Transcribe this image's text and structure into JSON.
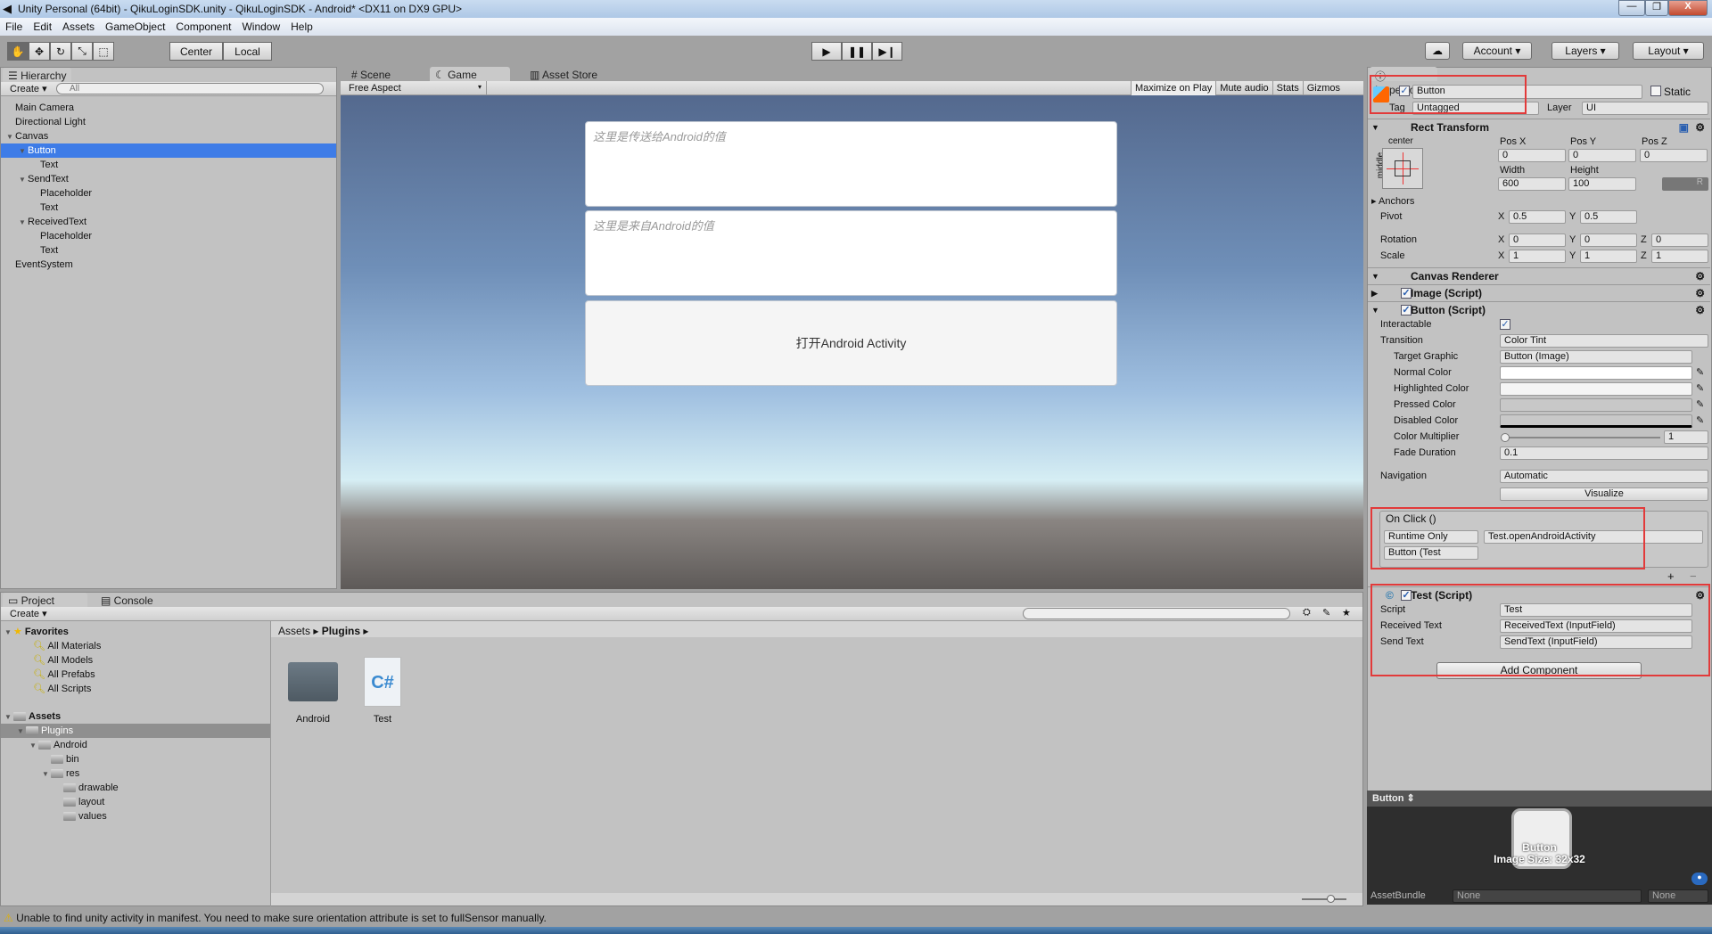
{
  "window": {
    "title": "Unity Personal (64bit) - QikuLoginSDK.unity - QikuLoginSDK - Android* <DX11 on DX9 GPU>",
    "minimize": "—",
    "maximize": "❐",
    "close": "X"
  },
  "menu": [
    "File",
    "Edit",
    "Assets",
    "GameObject",
    "Component",
    "Window",
    "Help"
  ],
  "toolbar": {
    "pivot": "Center",
    "space": "Local",
    "account": "Account",
    "layers": "Layers",
    "layout": "Layout"
  },
  "hierarchy": {
    "tab": "Hierarchy",
    "create": "Create",
    "search_placeholder": "All",
    "items": [
      {
        "label": "Main Camera",
        "depth": 0
      },
      {
        "label": "Directional Light",
        "depth": 0
      },
      {
        "label": "Canvas",
        "depth": 0,
        "expanded": true
      },
      {
        "label": "Button",
        "depth": 1,
        "expanded": true,
        "selected": true
      },
      {
        "label": "Text",
        "depth": 2
      },
      {
        "label": "SendText",
        "depth": 1,
        "expanded": true
      },
      {
        "label": "Placeholder",
        "depth": 2
      },
      {
        "label": "Text",
        "depth": 2
      },
      {
        "label": "ReceivedText",
        "depth": 1,
        "expanded": true
      },
      {
        "label": "Placeholder",
        "depth": 2
      },
      {
        "label": "Text",
        "depth": 2
      },
      {
        "label": "EventSystem",
        "depth": 0
      }
    ]
  },
  "game": {
    "tabs": [
      "Scene",
      "Game",
      "Asset Store"
    ],
    "active_tab": "Game",
    "aspect": "Free Aspect",
    "options": [
      "Maximize on Play",
      "Mute audio",
      "Stats",
      "Gizmos"
    ],
    "send_placeholder": "这里是传送给Android的值",
    "received_placeholder": "这里是来自Android的值",
    "button_label": "打开Android Activity"
  },
  "inspector": {
    "tab": "Inspector",
    "object_name": "Button",
    "active": true,
    "static_label": "Static",
    "tag_label": "Tag",
    "tag": "Untagged",
    "layer_label": "Layer",
    "layer": "UI",
    "rect_transform": {
      "title": "Rect Transform",
      "anchor_h": "center",
      "anchor_v": "middle",
      "pos_x_label": "Pos X",
      "pos_y_label": "Pos Y",
      "pos_z_label": "Pos Z",
      "pos_x": "0",
      "pos_y": "0",
      "pos_z": "0",
      "width_label": "Width",
      "height_label": "Height",
      "width": "600",
      "height": "100",
      "anchors": "Anchors",
      "pivot_label": "Pivot",
      "pivot_x": "0.5",
      "pivot_y": "0.5",
      "rotation_label": "Rotation",
      "rot_x": "0",
      "rot_y": "0",
      "rot_z": "0",
      "scale_label": "Scale",
      "scale_x": "1",
      "scale_y": "1",
      "scale_z": "1",
      "x": "X",
      "y": "Y",
      "z": "Z",
      "r": "R"
    },
    "canvas_renderer": "Canvas Renderer",
    "image_script": "Image (Script)",
    "button_script": {
      "title": "Button (Script)",
      "interactable_label": "Interactable",
      "interactable": true,
      "transition_label": "Transition",
      "transition": "Color Tint",
      "target_graphic_label": "Target Graphic",
      "target_graphic": "Button (Image)",
      "normal_label": "Normal Color",
      "highlighted_label": "Highlighted Color",
      "pressed_label": "Pressed Color",
      "disabled_label": "Disabled Color",
      "normal_color": "#ffffff",
      "highlighted_color": "#f5f5f5",
      "pressed_color": "#c8c8c8",
      "disabled_color": "#c8c8c8",
      "multiplier_label": "Color Multiplier",
      "multiplier": "1",
      "fade_label": "Fade Duration",
      "fade": "0.1",
      "navigation_label": "Navigation",
      "navigation": "Automatic",
      "visualize": "Visualize",
      "on_click": {
        "title": "On Click ()",
        "mode": "Runtime Only",
        "function": "Test.openAndroidActivity",
        "object": "Button (Test",
        "add": "+",
        "remove": "−"
      }
    },
    "test_script": {
      "title": "Test (Script)",
      "script_label": "Script",
      "script": "Test",
      "received_label": "Received Text",
      "received": "ReceivedText (InputField)",
      "send_label": "Send Text",
      "send": "SendText (InputField)"
    },
    "add_component": "Add Component",
    "preview": {
      "title": "Button",
      "name": "Button",
      "size": "Image Size: 32x32",
      "assetbundle_label": "AssetBundle",
      "bundle": "None",
      "variant": "None"
    }
  },
  "project": {
    "tabs": [
      "Project",
      "Console"
    ],
    "create": "Create",
    "favorites": "Favorites",
    "favorite_items": [
      "All Materials",
      "All Models",
      "All Prefabs",
      "All Scripts"
    ],
    "assets": "Assets",
    "tree": [
      {
        "label": "Plugins",
        "depth": 1,
        "selected": true
      },
      {
        "label": "Android",
        "depth": 2
      },
      {
        "label": "bin",
        "depth": 3
      },
      {
        "label": "res",
        "depth": 3
      },
      {
        "label": "drawable",
        "depth": 4
      },
      {
        "label": "layout",
        "depth": 4
      },
      {
        "label": "values",
        "depth": 4
      }
    ],
    "breadcrumb": [
      "Assets",
      "Plugins"
    ],
    "files": [
      {
        "name": "Android",
        "type": "folder"
      },
      {
        "name": "Test",
        "type": "csharp"
      }
    ]
  },
  "status": {
    "message": "Unable to find unity activity in manifest. You need to make sure orientation attribute is set to fullSensor manually."
  },
  "colors": {
    "selection": "#3e7ce7",
    "highlight_box": "#e23a3a",
    "panel": "#c2c2c2"
  }
}
